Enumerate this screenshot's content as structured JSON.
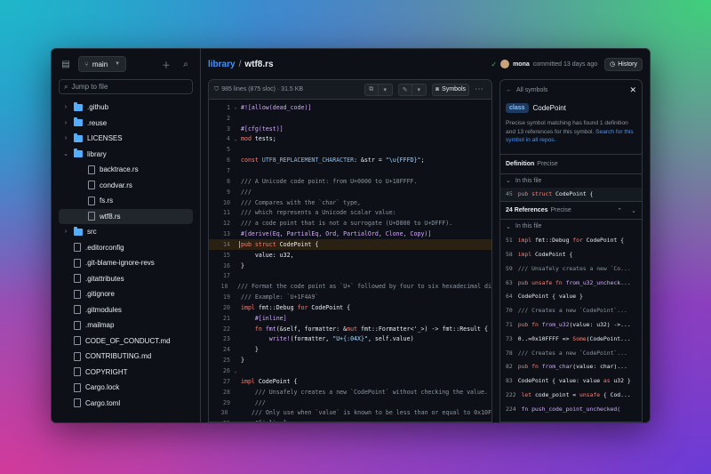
{
  "sidebar": {
    "branch": "main",
    "search_placeholder": "Jump to file",
    "tree": [
      {
        "type": "folder",
        "label": ".github",
        "expanded": false,
        "indent": 0
      },
      {
        "type": "folder",
        "label": ".reuse",
        "expanded": false,
        "indent": 0
      },
      {
        "type": "folder",
        "label": "LICENSES",
        "expanded": false,
        "indent": 0
      },
      {
        "type": "folder",
        "label": "library",
        "expanded": true,
        "indent": 0
      },
      {
        "type": "file",
        "label": "backtrace.rs",
        "indent": 1
      },
      {
        "type": "file",
        "label": "condvar.rs",
        "indent": 1
      },
      {
        "type": "file",
        "label": "fs.rs",
        "indent": 1
      },
      {
        "type": "file",
        "label": "wtf8.rs",
        "indent": 1,
        "selected": true
      },
      {
        "type": "folder",
        "label": "src",
        "expanded": false,
        "indent": 0
      },
      {
        "type": "file",
        "label": ".editorconfig",
        "indent": 0
      },
      {
        "type": "file",
        "label": ".git-blame-ignore-revs",
        "indent": 0
      },
      {
        "type": "file",
        "label": ".gitattributes",
        "indent": 0
      },
      {
        "type": "file",
        "label": ".gitignore",
        "indent": 0
      },
      {
        "type": "file",
        "label": ".gitmodules",
        "indent": 0
      },
      {
        "type": "file",
        "label": ".mailmap",
        "indent": 0
      },
      {
        "type": "file",
        "label": "CODE_OF_CONDUCT.md",
        "indent": 0
      },
      {
        "type": "file",
        "label": "CONTRIBUTING.md",
        "indent": 0
      },
      {
        "type": "file",
        "label": "COPYRIGHT",
        "indent": 0
      },
      {
        "type": "file",
        "label": "Cargo.lock",
        "indent": 0
      },
      {
        "type": "file",
        "label": "Cargo.toml",
        "indent": 0
      }
    ]
  },
  "header": {
    "breadcrumb_dir": "library",
    "breadcrumb_sep": "/",
    "breadcrumb_file": "wtf8.rs",
    "author": "mona",
    "commit_text": "committed 13 days ago",
    "history_label": "History"
  },
  "code": {
    "meta": "985 lines (875 sloc) · 31.5 KB",
    "symbols_label": "Symbols",
    "lines": [
      {
        "n": "1",
        "fold": "⌄",
        "html": "<span class='at'>#![allow(dead_code)]</span>"
      },
      {
        "n": "2",
        "fold": "",
        "html": ""
      },
      {
        "n": "3",
        "fold": "",
        "html": "<span class='at'>#[cfg(test)]</span>"
      },
      {
        "n": "4",
        "fold": "⌄",
        "html": "<span class='kw'>mod</span> tests;"
      },
      {
        "n": "5",
        "fold": "",
        "html": ""
      },
      {
        "n": "6",
        "fold": "",
        "html": "<span class='kw'>const</span> <span class='mc'>UTF8_REPLACEMENT_CHARACTER</span>: &amp;str = <span class='st'>\"\\u{FFFD}\"</span>;"
      },
      {
        "n": "7",
        "fold": "",
        "html": ""
      },
      {
        "n": "8",
        "fold": "",
        "html": "<span class='cm'>/// A Unicode code point: from U+0000 to U+10FFFF.</span>"
      },
      {
        "n": "9",
        "fold": "",
        "html": "<span class='cm'>///</span>"
      },
      {
        "n": "10",
        "fold": "",
        "html": "<span class='cm'>/// Compares with the `char` type,</span>"
      },
      {
        "n": "11",
        "fold": "",
        "html": "<span class='cm'>/// which represents a Unicode scalar value:</span>"
      },
      {
        "n": "12",
        "fold": "",
        "html": "<span class='cm'>/// a code point that is not a surrogate (U+D800 to U+DFFF).</span>"
      },
      {
        "n": "13",
        "fold": "",
        "html": "<span class='at'>#[derive(Eq, PartialEq, Ord, PartialOrd, Clone, Copy)]</span>"
      },
      {
        "n": "14",
        "fold": "",
        "hl": true,
        "html": "<span class='kw'>pub struct</span> CodePoint {"
      },
      {
        "n": "15",
        "fold": "",
        "html": "    value: u32,"
      },
      {
        "n": "16",
        "fold": "",
        "html": "}"
      },
      {
        "n": "17",
        "fold": "",
        "html": ""
      },
      {
        "n": "18",
        "fold": "",
        "html": "<span class='cm'>/// Format the code point as `U+` followed by four to six hexadecimal di</span>"
      },
      {
        "n": "19",
        "fold": "",
        "html": "<span class='cm'>/// Example: `U+1F4A9`</span>"
      },
      {
        "n": "20",
        "fold": "",
        "html": "<span class='kw'>impl</span> fmt::Debug <span class='kw'>for</span> CodePoint {"
      },
      {
        "n": "21",
        "fold": "",
        "html": "    <span class='at'>#[inline]</span>"
      },
      {
        "n": "22",
        "fold": "",
        "html": "    <span class='kw'>fn</span> <span class='fn'>fmt</span>(&amp;self, formatter: &amp;<span class='kw'>mut</span> fmt::Formatter&lt;'_&gt;) -&gt; fmt::Result {"
      },
      {
        "n": "23",
        "fold": "",
        "html": "        <span class='fn'>write!</span>(formatter, <span class='st'>\"U+{:04X}\"</span>, self.value)"
      },
      {
        "n": "24",
        "fold": "",
        "html": "    }"
      },
      {
        "n": "25",
        "fold": "",
        "html": "}"
      },
      {
        "n": "26",
        "fold": "⌄",
        "html": ""
      },
      {
        "n": "27",
        "fold": "",
        "html": "<span class='kw'>impl</span> CodePoint {"
      },
      {
        "n": "28",
        "fold": "",
        "html": "    <span class='cm'>/// Unsafely creates a new `CodePoint` without checking the value.</span>"
      },
      {
        "n": "29",
        "fold": "",
        "html": "    <span class='cm'>///</span>"
      },
      {
        "n": "30",
        "fold": "",
        "html": "    <span class='cm'>/// Only use when `value` is known to be less than or equal to 0x10F</span>"
      },
      {
        "n": "31",
        "fold": "",
        "html": "    <span class='at'>#[inline]</span>"
      }
    ]
  },
  "symbols": {
    "back_label": "All symbols",
    "kind": "class",
    "name": "CodePoint",
    "desc_prefix": "Precise symbol matching has found 1 definition and 13 references for this symbol. ",
    "desc_link": "Search for this symbol in all repos.",
    "definition_label": "Definition",
    "definition_tag": "Precise",
    "in_this_file": "In this file",
    "definition_item": {
      "n": "45",
      "html": "<span class='kw'>pub struct</span> CodePoint {"
    },
    "refs_label": "24 References",
    "refs_tag": "Precise",
    "references": [
      {
        "n": "51",
        "html": "<span class='kw'>impl</span> fmt::Debug <span class='kw'>for</span> CodePoint {"
      },
      {
        "n": "58",
        "html": "<span class='kw'>impl</span> CodePoint {"
      },
      {
        "n": "59",
        "html": "<span class='cm'>/// Unsafely creates a new `Co...</span>"
      },
      {
        "n": "63",
        "html": "<span class='kw'>pub unsafe fn</span> <span class='fn'>from_u32_uncheck...</span>"
      },
      {
        "n": "64",
        "html": "CodePoint { value }"
      },
      {
        "n": "70",
        "html": "<span class='cm'>/// Creates a new `CodePoint`...</span>"
      },
      {
        "n": "71",
        "html": "<span class='kw'>pub fn</span> <span class='fn'>from_u32</span>(value: u32) -&gt;..."
      },
      {
        "n": "73",
        "html": "0..=0x10FFFF =&gt; <span class='kw'>Some</span>(CodePoint..."
      },
      {
        "n": "78",
        "html": "<span class='cm'>/// Creates a new `CodePoint`...</span>"
      },
      {
        "n": "82",
        "html": "<span class='kw'>pub fn</span> <span class='fn'>from_char</span>(value: char)..."
      },
      {
        "n": "83",
        "html": "CodePoint { value: value <span class='kw'>as</span> u32 }"
      },
      {
        "n": "222",
        "html": "<span class='kw'>let</span> code_point = <span class='kw'>unsafe</span> { Cod..."
      },
      {
        "n": "224",
        "html": "<span class='fn'>fn push_code_point_unchecked(</span>"
      }
    ]
  }
}
